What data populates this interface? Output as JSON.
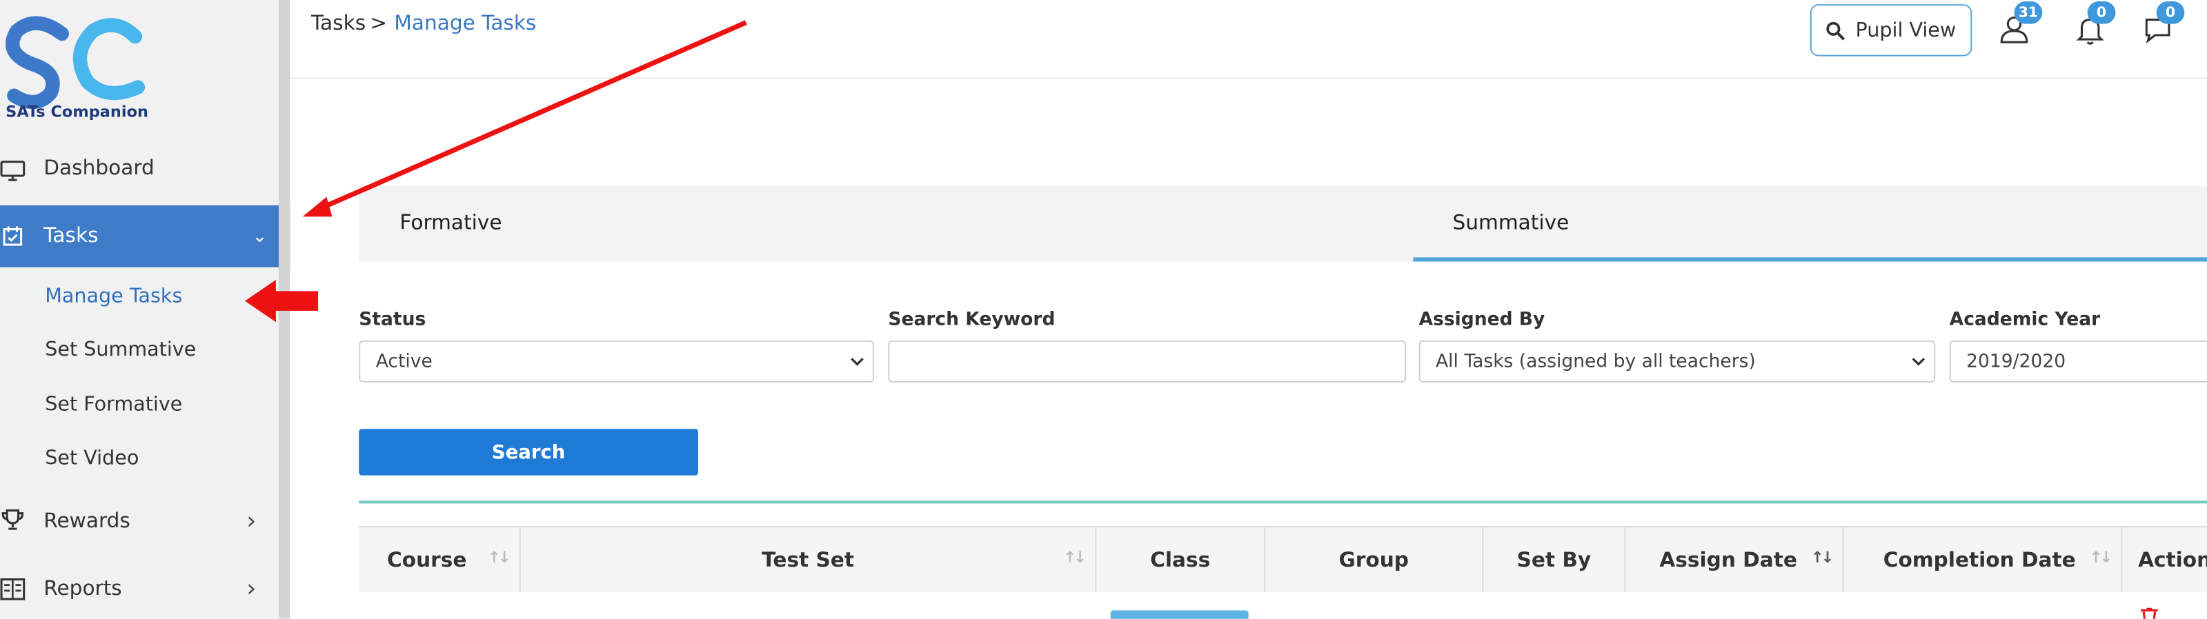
{
  "brand": {
    "logo_text": "SATs Companion",
    "logo_letters": "SC"
  },
  "sidebar": {
    "items": [
      {
        "label": "Dashboard",
        "icon": "monitor-icon"
      },
      {
        "label": "Tasks",
        "icon": "tasks-icon",
        "chevron": "⌄"
      },
      {
        "label": "Rewards",
        "icon": "trophy-icon",
        "chevron": "›"
      },
      {
        "label": "Reports",
        "icon": "reports-icon",
        "chevron": "›"
      }
    ],
    "subitems": [
      {
        "label": "Manage Tasks"
      },
      {
        "label": "Set Summative"
      },
      {
        "label": "Set Formative"
      },
      {
        "label": "Set Video"
      }
    ]
  },
  "header": {
    "breadcrumb_root": "Tasks",
    "breadcrumb_sep": ">",
    "breadcrumb_current": "Manage Tasks",
    "pupil_view_label": "Pupil View",
    "badges": {
      "users": "31",
      "notifications": "0",
      "messages": "0"
    }
  },
  "tabs": [
    {
      "label": "Formative"
    },
    {
      "label": "Summative",
      "active": true
    }
  ],
  "filters": {
    "status_label": "Status",
    "status_value": "Active",
    "keyword_label": "Search Keyword",
    "keyword_value": "",
    "assigned_by_label": "Assigned By",
    "assigned_by_value": "All Tasks (assigned by all teachers)",
    "academic_year_label": "Academic Year",
    "academic_year_value": "2019/2020",
    "search_button": "Search"
  },
  "table": {
    "columns": [
      "Course",
      "Test Set",
      "Class",
      "Group",
      "Set By",
      "Assign Date",
      "Completion Date",
      "Action"
    ]
  },
  "colors": {
    "sidebar_active": "#3f7bc7",
    "link": "#3a78c2",
    "primary_button": "#1f7ad6",
    "badge": "#3f97dc",
    "tab_underline": "#52a6dc",
    "annotation_arrow": "#ee1111"
  }
}
